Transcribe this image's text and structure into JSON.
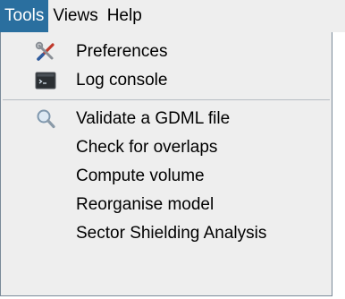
{
  "menubar": {
    "items": [
      {
        "label": "Tools"
      },
      {
        "label": "Views"
      },
      {
        "label": "Help"
      }
    ]
  },
  "tools_menu": {
    "group1": [
      {
        "label": "Preferences",
        "icon": "tools-icon"
      },
      {
        "label": "Log console",
        "icon": "terminal-icon"
      }
    ],
    "group2": [
      {
        "label": "Validate a GDML file",
        "icon": "magnifier-icon"
      },
      {
        "label": "Check for overlaps"
      },
      {
        "label": "Compute volume"
      },
      {
        "label": "Reorganise model"
      },
      {
        "label": "Sector Shielding Analysis"
      }
    ]
  },
  "colors": {
    "active_menu_bg": "#2a6f9f",
    "menu_bg": "#eeeeee"
  }
}
